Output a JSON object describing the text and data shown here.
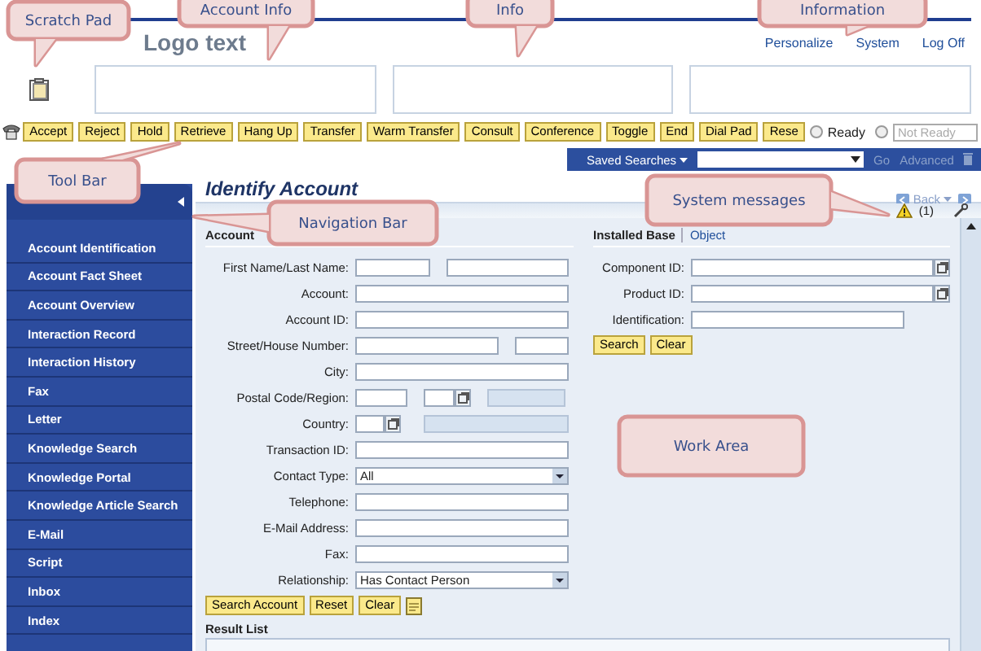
{
  "header": {
    "logo": "Logo text",
    "links": [
      "Personalize",
      "System",
      "Log Off"
    ]
  },
  "toolbar": {
    "buttons": [
      "Accept",
      "Reject",
      "Hold",
      "Retrieve",
      "Hang Up",
      "Transfer",
      "Warm Transfer",
      "Consult",
      "Conference",
      "Toggle",
      "End",
      "Dial Pad",
      "Rese"
    ],
    "status_radios": [
      {
        "label": "Ready",
        "selected": false
      },
      {
        "selected": false
      }
    ],
    "status_dropdown": "Not Ready"
  },
  "saved_searches": {
    "label": "Saved Searches",
    "go": "Go",
    "advanced": "Advanced"
  },
  "sidebar": {
    "items": [
      {
        "label": "Account Identification",
        "selected": false
      },
      {
        "label": "Account Fact Sheet",
        "selected": false
      },
      {
        "label": "Account Overview",
        "selected": false
      },
      {
        "label": "Interaction Record",
        "selected": false
      },
      {
        "label": "Interaction History",
        "selected": false
      },
      {
        "label": "Fax",
        "selected": false
      },
      {
        "label": "Letter",
        "selected": false
      },
      {
        "label": "Knowledge Search",
        "selected": false
      },
      {
        "label": "Knowledge Portal",
        "selected": false
      },
      {
        "label": "Knowledge Article Search",
        "selected": false
      },
      {
        "label": "E-Mail",
        "selected": false
      },
      {
        "label": "Script",
        "selected": false
      },
      {
        "label": "Inbox",
        "selected": false
      },
      {
        "label": "Index",
        "selected": false
      }
    ]
  },
  "page": {
    "title": "Identify Account",
    "back": "Back",
    "message_count": "(1)"
  },
  "account": {
    "heading": "Account",
    "fields": [
      {
        "label": "First Name/Last Name:",
        "kind": "pair"
      },
      {
        "label": "Account:",
        "kind": "text"
      },
      {
        "label": "Account ID:",
        "kind": "text"
      },
      {
        "label": "Street/House Number:",
        "kind": "street"
      },
      {
        "label": "City:",
        "kind": "text"
      },
      {
        "label": "Postal Code/Region:",
        "kind": "postal"
      },
      {
        "label": "Country:",
        "kind": "country"
      },
      {
        "label": "Transaction ID:",
        "kind": "text"
      },
      {
        "label": "Contact Type:",
        "kind": "dropdown",
        "value": "All"
      },
      {
        "label": "Telephone:",
        "kind": "text"
      },
      {
        "label": "E-Mail Address:",
        "kind": "text"
      },
      {
        "label": "Fax:",
        "kind": "text"
      },
      {
        "label": "Relationship:",
        "kind": "dropdown",
        "value": "Has Contact Person"
      }
    ],
    "buttons": [
      "Search Account",
      "Reset",
      "Clear"
    ]
  },
  "installed_base": {
    "heading": "Installed Base",
    "link": "Object",
    "fields": [
      {
        "label": "Component ID:",
        "kind": "lookup"
      },
      {
        "label": "Product ID:",
        "kind": "lookup"
      },
      {
        "label": "Identification:",
        "kind": "text"
      }
    ],
    "buttons": [
      "Search",
      "Clear"
    ]
  },
  "result_list": {
    "heading": "Result List"
  },
  "callouts": [
    {
      "label": "Scratch Pad"
    },
    {
      "label": "Account Info"
    },
    {
      "label": "Info"
    },
    {
      "label": "Information"
    },
    {
      "label": "Tool Bar"
    },
    {
      "label": "Navigation Bar"
    },
    {
      "label": "System messages"
    },
    {
      "label": "Work Area"
    }
  ]
}
